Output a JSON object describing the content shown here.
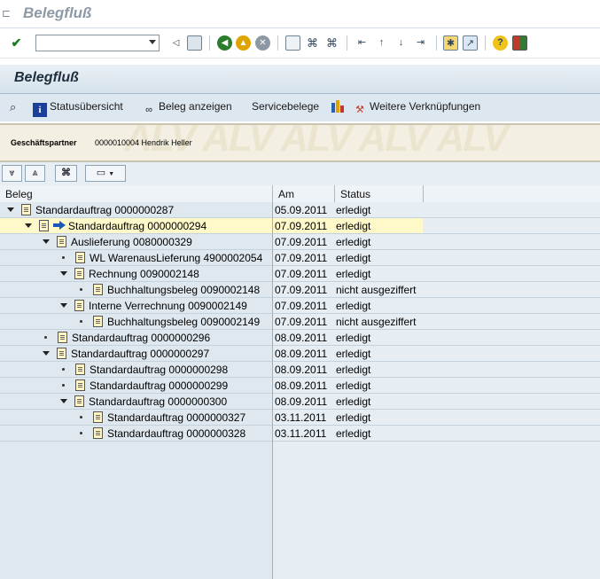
{
  "window": {
    "title": "Belegfluß"
  },
  "toolbar": {
    "command_field_value": "",
    "icons": [
      "check-icon",
      "back-arrow-icon",
      "save-icon",
      "back-icon",
      "exit-icon",
      "cancel-icon",
      "print-icon",
      "find-icon",
      "find-next-icon",
      "first-page-icon",
      "prev-page-icon",
      "next-page-icon",
      "last-page-icon",
      "new-session-icon",
      "shortcut-icon",
      "help-icon",
      "layout-icon"
    ]
  },
  "header": {
    "title": "Belegfluß"
  },
  "app_toolbar": {
    "status_overview": "Statusübersicht",
    "show_document": "Beleg anzeigen",
    "service_documents": "Servicebelege",
    "more_links": "Weitere Verknüpfungen"
  },
  "alv_header": {
    "partner_label": "Geschäftspartner",
    "partner_value": "0000010004 Hendrik Heller",
    "watermark": "ALV ALV ALV ALV ALV"
  },
  "columns": {
    "beleg": "Beleg",
    "am": "Am",
    "status": "Status"
  },
  "rows": [
    {
      "label": "Standardauftrag 0000000287",
      "am": "05.09.2011",
      "status": "erledigt"
    },
    {
      "label": "Standardauftrag 0000000294",
      "am": "07.09.2011",
      "status": "erledigt"
    },
    {
      "label": "Auslieferung 0080000329",
      "am": "07.09.2011",
      "status": "erledigt"
    },
    {
      "label": "WL WarenausLieferung 4900002054",
      "am": "07.09.2011",
      "status": "erledigt"
    },
    {
      "label": "Rechnung 0090002148",
      "am": "07.09.2011",
      "status": "erledigt"
    },
    {
      "label": "Buchhaltungsbeleg 0090002148",
      "am": "07.09.2011",
      "status": "nicht ausgeziffert"
    },
    {
      "label": "Interne Verrechnung 0090002149",
      "am": "07.09.2011",
      "status": "erledigt"
    },
    {
      "label": "Buchhaltungsbeleg 0090002149",
      "am": "07.09.2011",
      "status": "nicht ausgeziffert"
    },
    {
      "label": "Standardauftrag 0000000296",
      "am": "08.09.2011",
      "status": "erledigt"
    },
    {
      "label": "Standardauftrag 0000000297",
      "am": "08.09.2011",
      "status": "erledigt"
    },
    {
      "label": "Standardauftrag 0000000298",
      "am": "08.09.2011",
      "status": "erledigt"
    },
    {
      "label": "Standardauftrag 0000000299",
      "am": "08.09.2011",
      "status": "erledigt"
    },
    {
      "label": "Standardauftrag 0000000300",
      "am": "08.09.2011",
      "status": "erledigt"
    },
    {
      "label": "Standardauftrag 0000000327",
      "am": "03.11.2011",
      "status": "erledigt"
    },
    {
      "label": "Standardauftrag 0000000328",
      "am": "03.11.2011",
      "status": "erledigt"
    }
  ],
  "colors": {
    "highlight_row": "#fff8c9",
    "header_bg": "#d6e2eb",
    "tree_bg": "#e6edf3"
  }
}
